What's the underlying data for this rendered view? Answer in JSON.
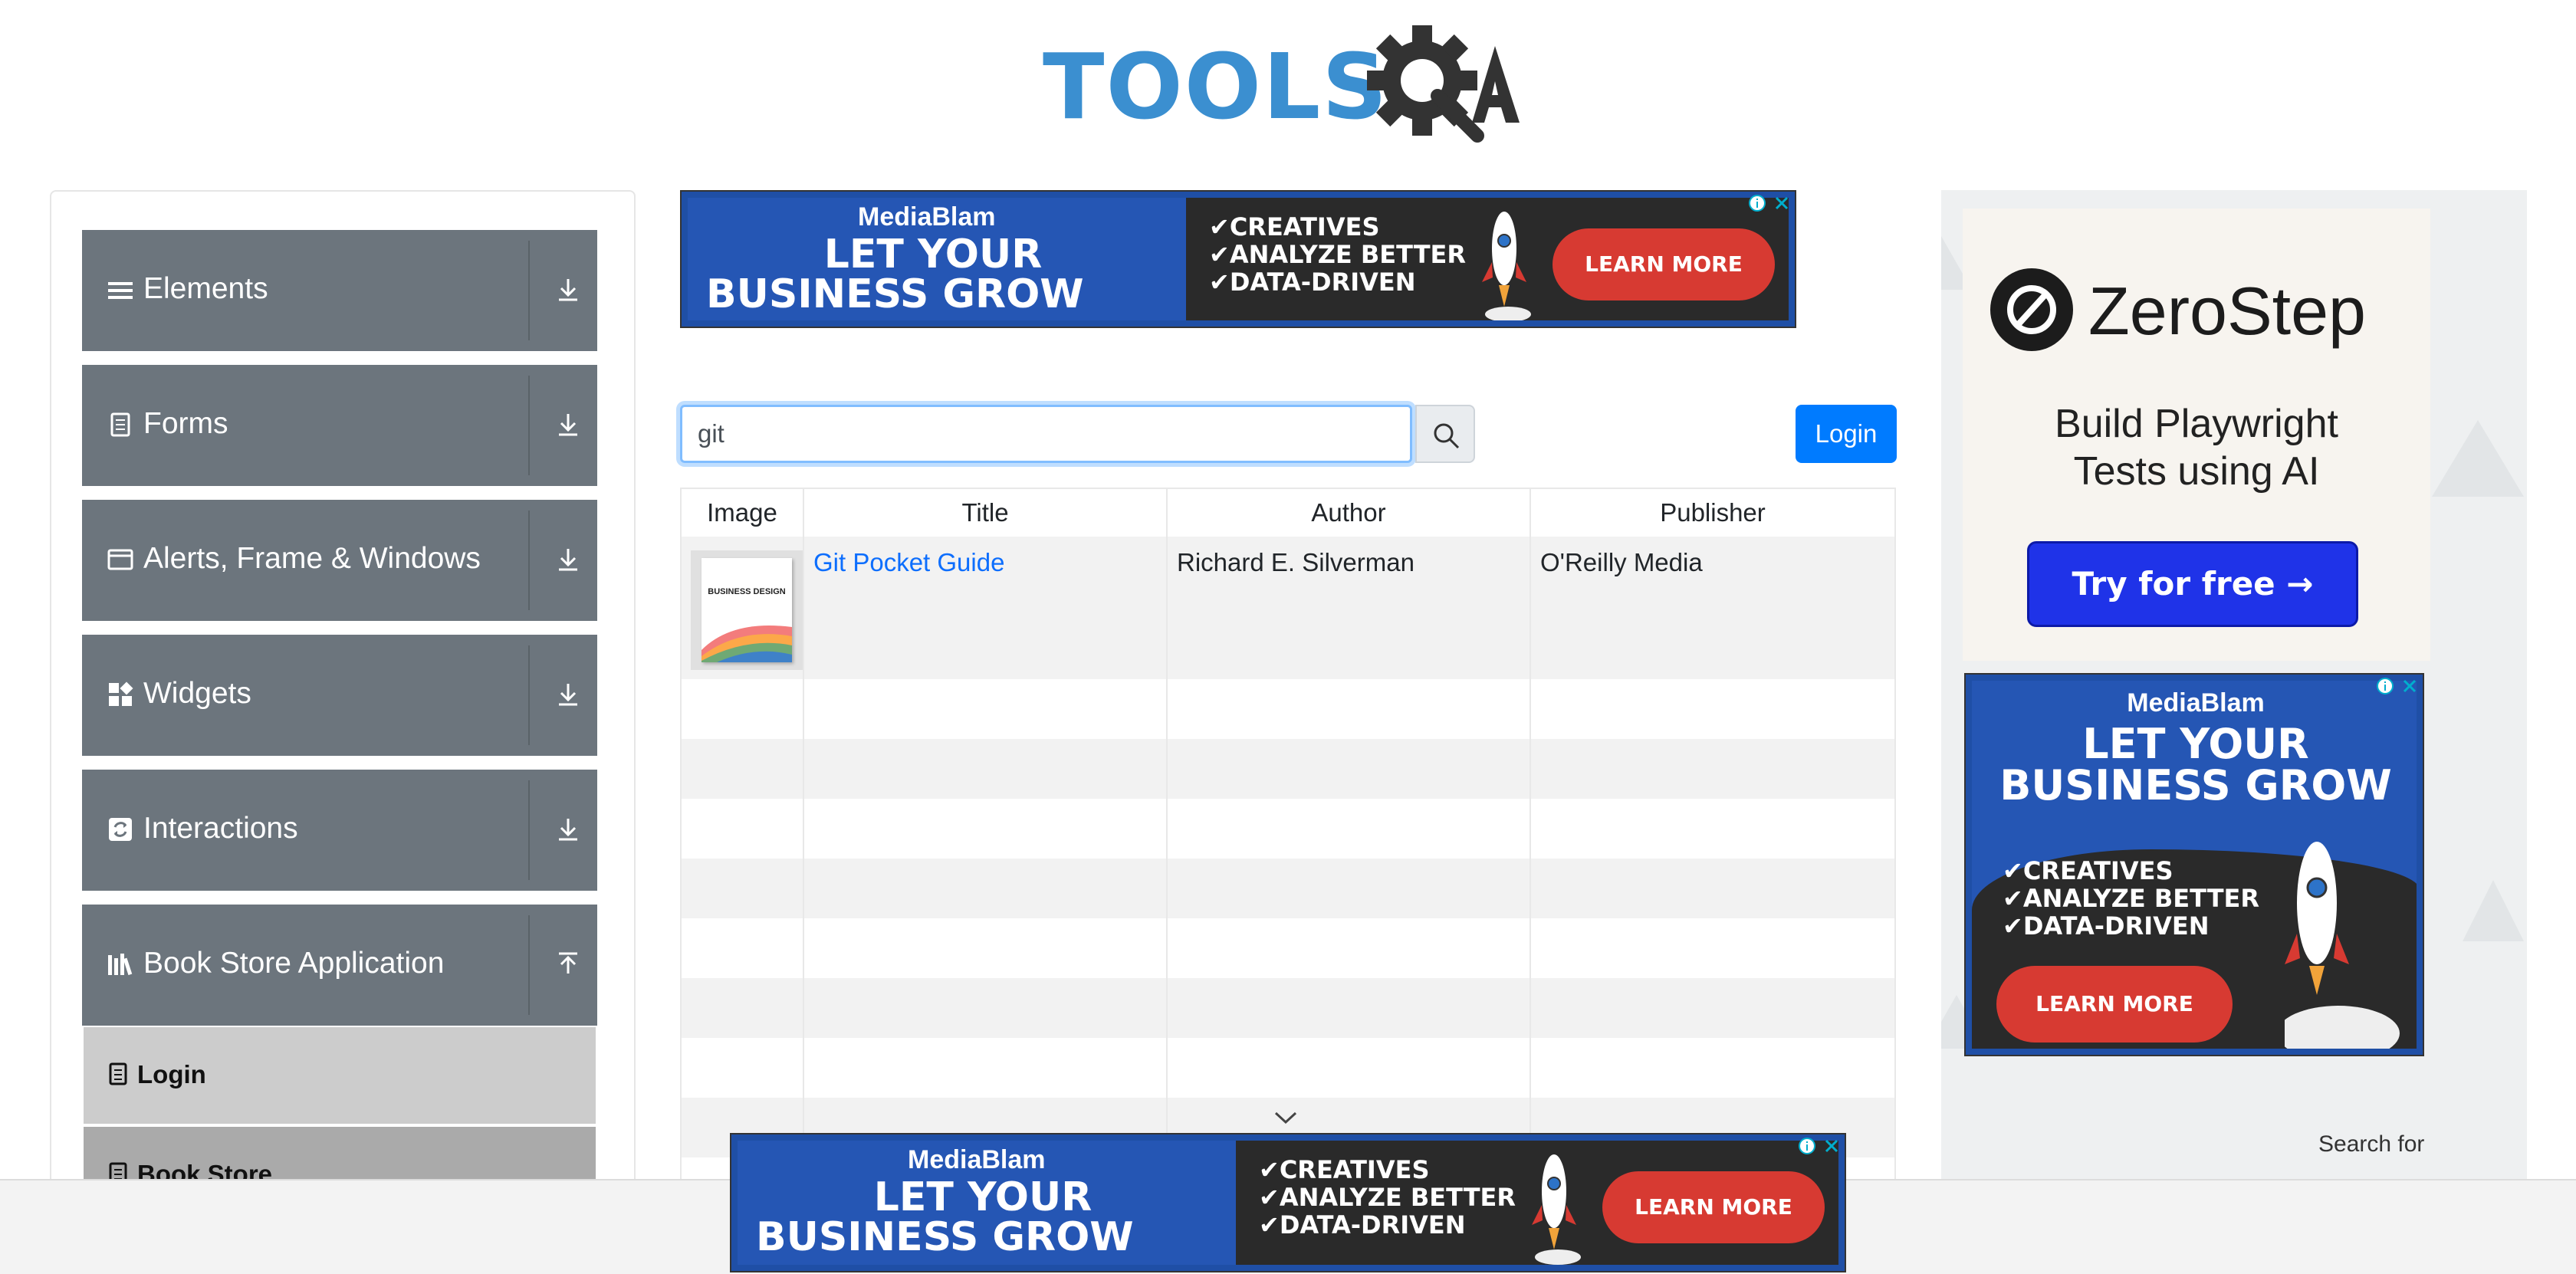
{
  "logo": {
    "left": "TOOLS",
    "right": "QA"
  },
  "sidebar": {
    "groups": [
      {
        "label": "Elements",
        "icon": "hamburger-icon",
        "arrow": "download-arrow-icon"
      },
      {
        "label": "Forms",
        "icon": "document-icon",
        "arrow": "download-arrow-icon"
      },
      {
        "label": "Alerts, Frame & Windows",
        "icon": "window-icon",
        "arrow": "download-arrow-icon"
      },
      {
        "label": "Widgets",
        "icon": "widgets-icon",
        "arrow": "download-arrow-icon"
      },
      {
        "label": "Interactions",
        "icon": "interactions-icon",
        "arrow": "download-arrow-icon"
      },
      {
        "label": "Book Store Application",
        "icon": "books-icon",
        "arrow": "upload-arrow-icon"
      }
    ],
    "subitems": [
      {
        "label": "Login",
        "icon": "document-icon"
      },
      {
        "label": "Book Store",
        "icon": "document-icon"
      }
    ]
  },
  "ads": {
    "brand": "MediaBlam",
    "headline_1": "LET YOUR",
    "headline_2": "BUSINESS GROW",
    "bullets": [
      "✔CREATIVES",
      "✔ANALYZE BETTER",
      "✔DATA-DRIVEN"
    ],
    "cta": "LEARN MORE",
    "colors": {
      "blue": "#2556b4",
      "dark": "#2a2a2a",
      "red": "#d73a32"
    }
  },
  "search": {
    "value": "git"
  },
  "login_button": "Login",
  "table": {
    "headers": [
      "Image",
      "Title",
      "Author",
      "Publisher"
    ],
    "rows": [
      {
        "title": "Git Pocket Guide",
        "author": "Richard E. Silverman",
        "publisher": "O'Reilly Media",
        "cover_text": "BUSINESS DESIGN"
      }
    ]
  },
  "zerostep": {
    "name": "ZeroStep",
    "tagline_1": "Build Playwright",
    "tagline_2": "Tests using AI",
    "button": "Try for free →"
  },
  "right_search_label": "Search for"
}
